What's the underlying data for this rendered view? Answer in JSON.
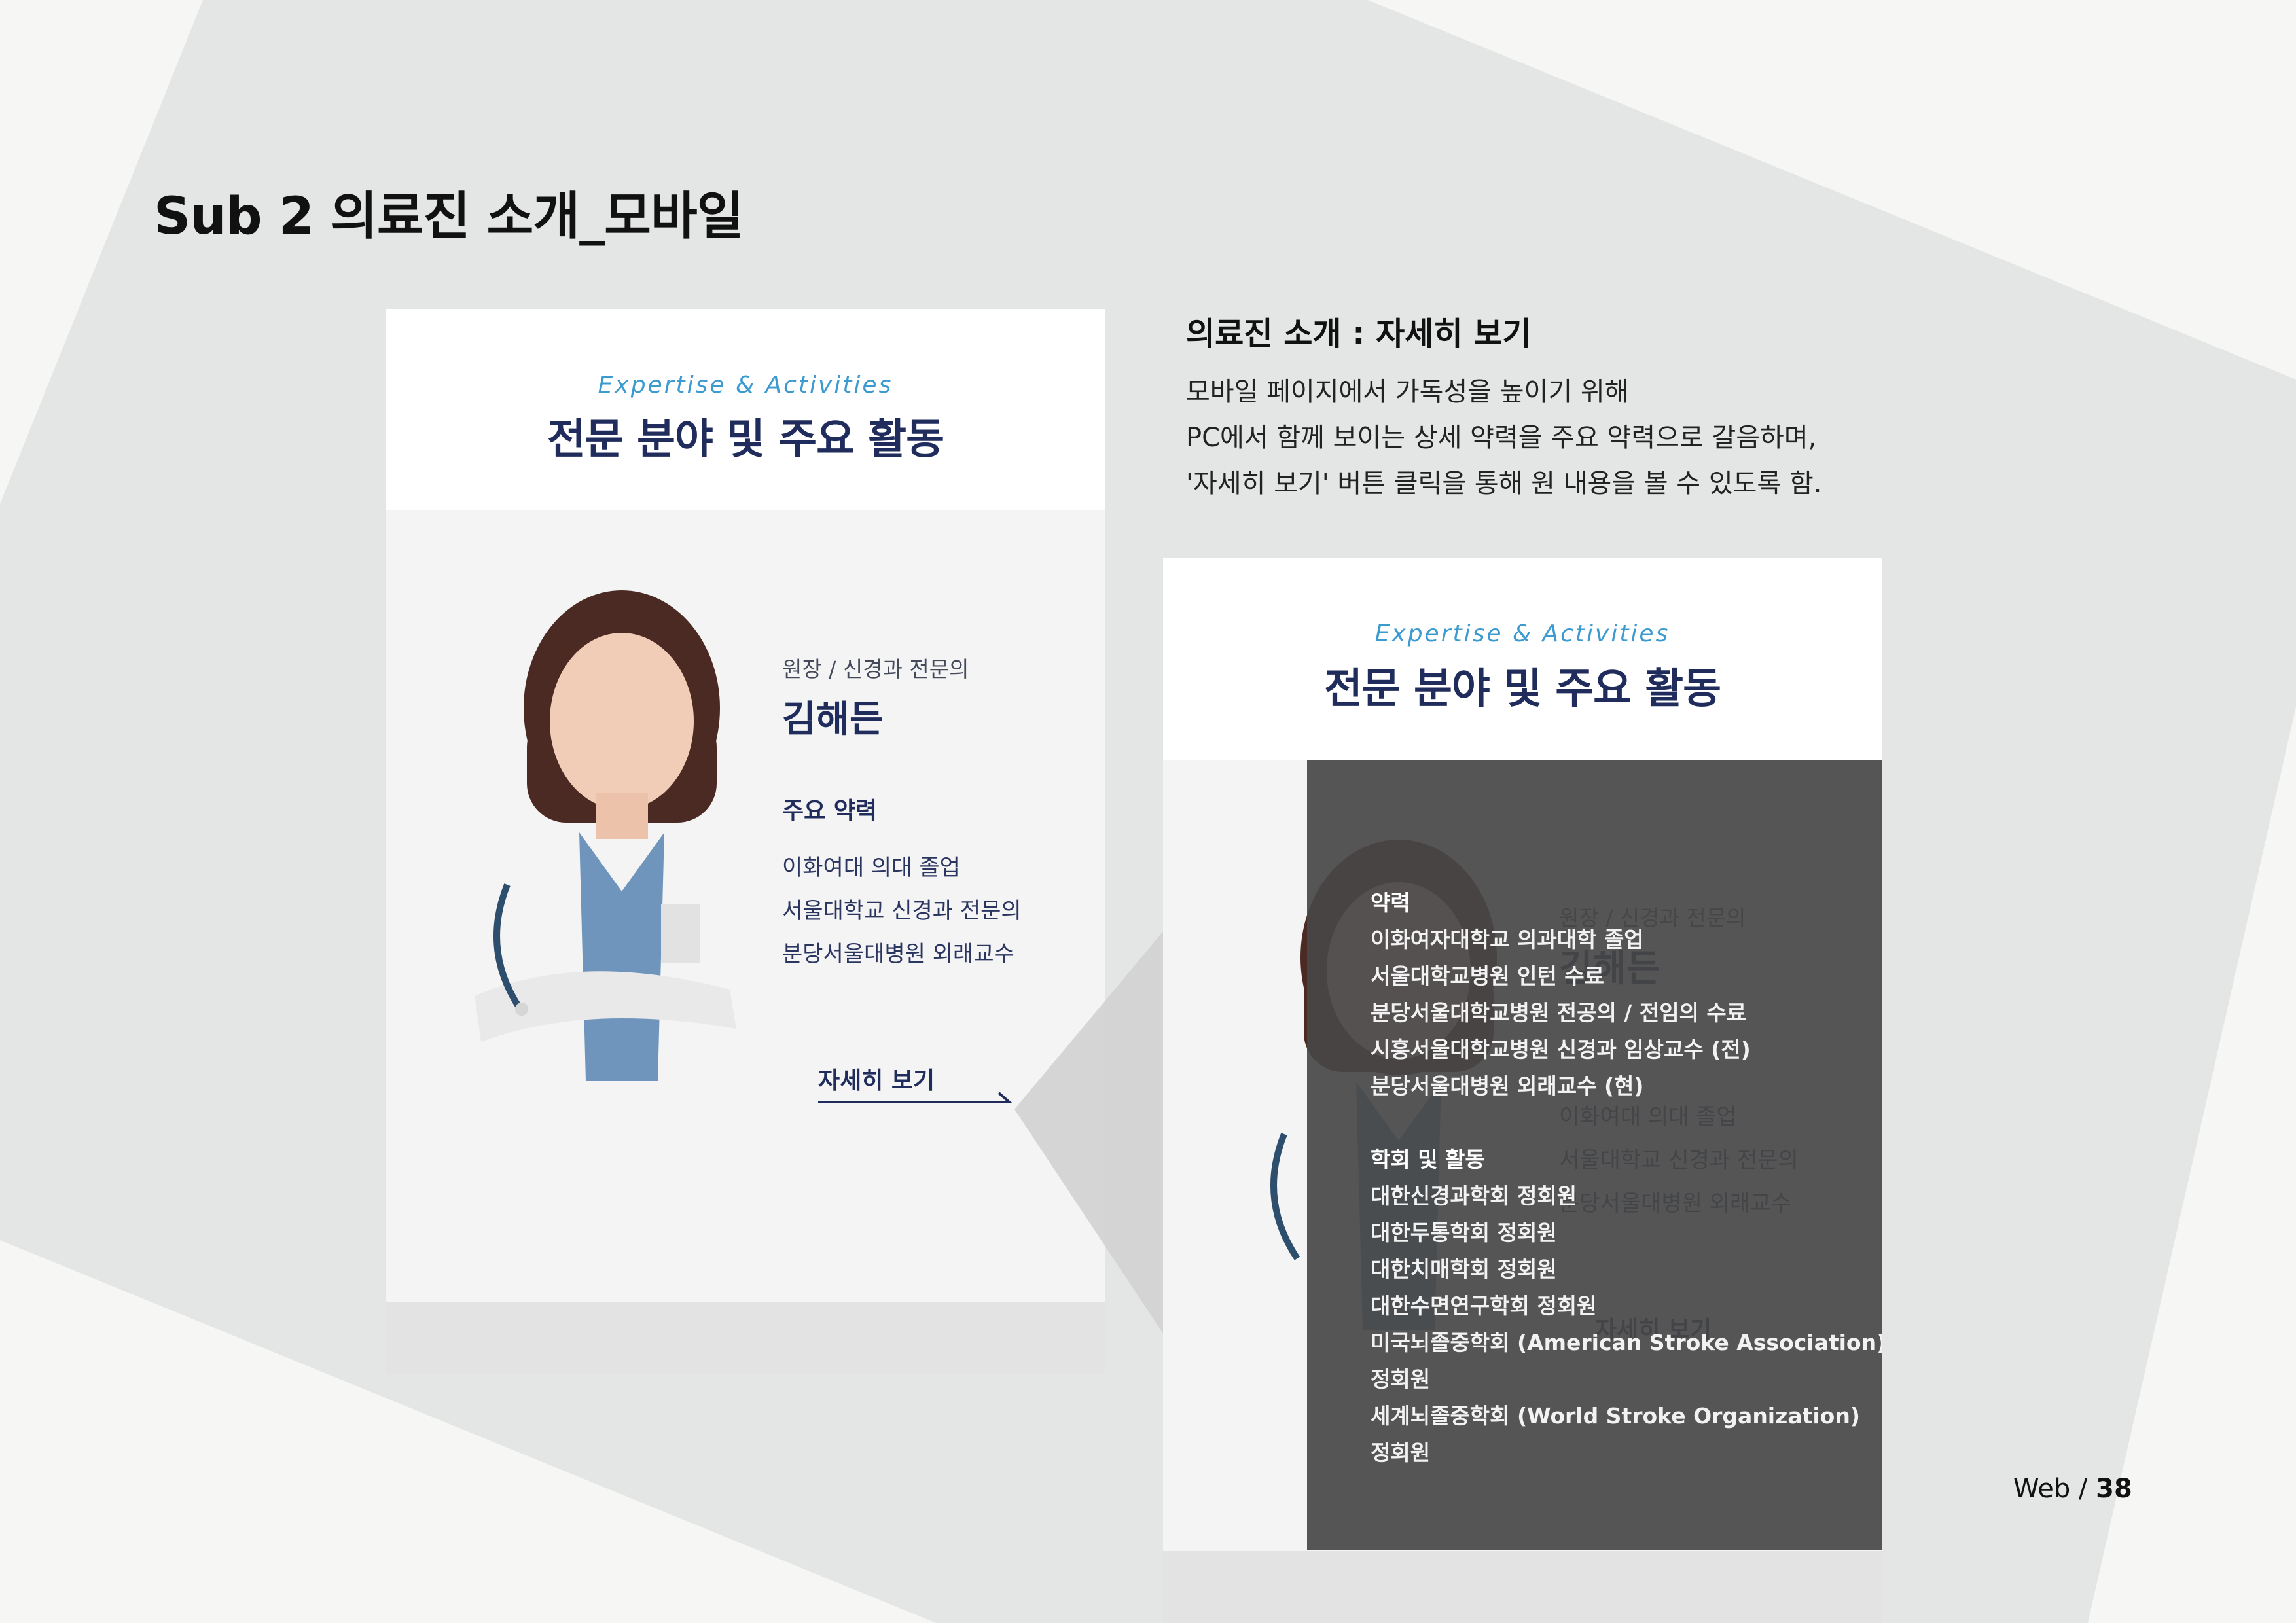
{
  "page": {
    "title": "Sub 2 의료진 소개_모바일"
  },
  "section": {
    "eyebrow": "Expertise & Activities",
    "title": "전문 분야 및 주요 활동"
  },
  "doctor": {
    "role": "원장 / 신경과 전문의",
    "name": "김해든",
    "career_heading": "주요 약력",
    "career": [
      "이화여대 의대 졸업",
      "서울대학교 신경과 전문의",
      "분당서울대병원 외래교수"
    ],
    "detail_link": "자세히 보기"
  },
  "description": {
    "heading": "의료진 소개 : 자세히 보기",
    "lines": [
      "모바일 페이지에서 가독성을 높이기 위해",
      "PC에서 함께 보이는 상세 약력을 주요 약력으로 갈음하며,",
      "'자세히 보기' 버튼 클릭을 통해 원 내용을 볼 수 있도록 함."
    ]
  },
  "overlay": {
    "career_heading": "약력",
    "career": [
      "이화여자대학교 의과대학 졸업",
      "서울대학교병원 인턴 수료",
      "분당서울대학교병원 전공의 / 전임의 수료",
      "시흥서울대학교병원 신경과 임상교수 (전)",
      "분당서울대병원 외래교수 (현)"
    ],
    "activities_heading": "학회 및 활동",
    "activities": [
      "대한신경과학회 정회원",
      "대한두통학회 정회원",
      "대한치매학회 정회원",
      "대한수면연구학회 정회원",
      "미국뇌졸중학회 (American Stroke Association)",
      "정회원",
      "세계뇌졸중학회 (World Stroke Organization)",
      "정회원"
    ]
  },
  "footer": {
    "prefix": "Web / ",
    "page_number": "38"
  },
  "colors": {
    "navy": "#1f2c5c",
    "accent": "#3b9ad0",
    "overlay": "#474747"
  }
}
